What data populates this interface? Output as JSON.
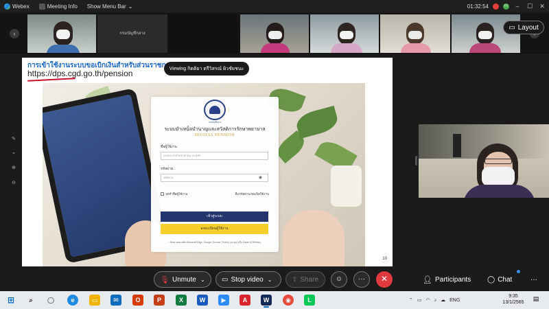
{
  "titlebar": {
    "app_name": "Webex",
    "meeting_info": "Meeting Info",
    "menu_toggle": "Show Menu Bar",
    "timer": "01:32:54",
    "badge_red": "",
    "badge_green": "HI"
  },
  "strip": {
    "tiles": [
      {
        "name": ""
      },
      {
        "name": "กรมบัญชีกลาง"
      },
      {
        "name": ""
      },
      {
        "name": ""
      },
      {
        "name": ""
      },
      {
        "name": ""
      },
      {
        "name": ""
      }
    ],
    "layout_label": "Layout"
  },
  "slide": {
    "heading": "การเข้าใช้งานระบบขอเบิกเงินสำหรับส่วนราชการ",
    "url": "https://dps.cgd.go.th/pension",
    "viewing_label": "Viewing กิตติยา ตรีวิสรณ์ ผิวชัยชนะ",
    "seal_caption": "กรมบัญชีกลาง",
    "system_title": "ระบบบำเหน็จบำนาญและสวัสดิการรักษาพยาบาล",
    "digital_label": "DIGITAL PENSION",
    "username_label": "ชื่อผู้ใช้งาน",
    "username_placeholder": "เลขประจำตัวประชาชน 13 หลัก",
    "password_label": "รหัสผ่าน",
    "password_placeholder": "รหัสผ่าน",
    "remember_label": "จดจำชื่อผู้ใช้งาน",
    "forgot_label": "ลืมรหัสผ่าน/ขอเปิดใช้งาน",
    "login_label": "เข้าสู่ระบบ",
    "register_label": "ลงทะเบียนผู้ใช้งาน",
    "note": "* Best view with Microsoft Edge, Google Chrome, Firefox (ล่าสุด) หรือ Safari (iOS/Mac)",
    "page_number": "10"
  },
  "controls": {
    "unmute_label": "Unmute",
    "stop_video_label": "Stop video",
    "share_label": "Share",
    "participants_label": "Participants",
    "chat_label": "Chat",
    "more_label": "···",
    "end_label": "✕"
  },
  "taskbar": {
    "language": "ENG",
    "time": "9:35",
    "date": "13/1/2565"
  },
  "colors": {
    "end_call": "#e0393e",
    "login_button": "#24356e",
    "register_button": "#f7cf2b",
    "heading_blue": "#1a67c9"
  },
  "icons": {
    "mic": "mic-muted-icon",
    "video": "video-camera-icon",
    "share": "share-screen-icon",
    "reactions": "smile-icon",
    "participants": "people-icon",
    "chat": "chat-bubble-icon"
  }
}
